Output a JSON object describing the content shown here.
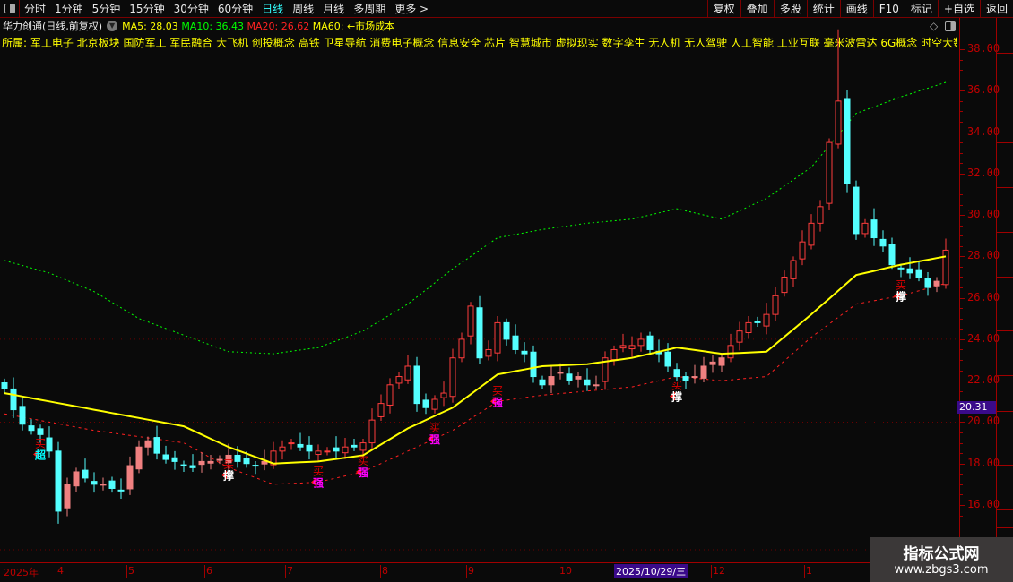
{
  "toolbar": {
    "periods": [
      "分时",
      "1分钟",
      "5分钟",
      "15分钟",
      "30分钟",
      "60分钟",
      "日线",
      "周线",
      "月线",
      "多周期",
      "更多 >"
    ],
    "active": "日线",
    "buttons": [
      "复权",
      "叠加",
      "多股",
      "统计",
      "画线",
      "F10",
      "标记",
      "+自选",
      "返回"
    ]
  },
  "header": {
    "title": "华力创通(日线,前复权)",
    "ma5": "MA5: 28.03",
    "ma10": "MA10: 36.43",
    "ma20": "MA20: 26.62",
    "ma60": "MA60:",
    "cost": "←市场成本",
    "ma_colors": {
      "ma5": "#ffff00",
      "ma10": "#00ff00",
      "ma20": "#ff2020",
      "ma60": "#ffff00"
    }
  },
  "concepts": "所属: 军工电子 北京板块 国防军工 军民融合 大飞机 创投概念 高铁 卫星导航 消费电子概念 信息安全 芯片 智慧城市 虚拟现实 数字孪生 无人机 无人驾驶 人工智能 工业互联 毫米波雷达 6G概念 时空大数据",
  "price_axis": {
    "ticks": [
      "38.00",
      "36.00",
      "34.00",
      "32.00",
      "30.00",
      "28.00",
      "26.00",
      "24.00",
      "22.00",
      "20.00",
      "18.00",
      "16.00"
    ],
    "current": "20.31"
  },
  "time_axis": {
    "labels": [
      "2025年",
      "4",
      "5",
      "6",
      "7",
      "8",
      "9",
      "10",
      "12",
      "1"
    ],
    "cursor_date": "2025/10/29/三"
  },
  "watermark": {
    "line1": "指标公式网",
    "line2": "www.zbgs3.com"
  },
  "chart_data": {
    "type": "candlestick",
    "ylim": [
      15,
      39
    ],
    "up_color": "#ff3c3c",
    "down_color": "#54ffff",
    "low_zone_color": "#f08080",
    "close": [
      21.6,
      20.6,
      19.9,
      19.6,
      19.4,
      18.6,
      15.7,
      17.0,
      17.6,
      17.3,
      17.0,
      17.0,
      16.8,
      16.7,
      17.9,
      18.8,
      19.1,
      18.5,
      18.2,
      18.1,
      17.9,
      17.8,
      18.1,
      18.1,
      18.2,
      18.4,
      18.1,
      18.0,
      17.9,
      18.1,
      18.6,
      18.8,
      19.0,
      18.8,
      18.6,
      18.6,
      18.6,
      18.6,
      18.8,
      18.8,
      19.0,
      20.1,
      20.9,
      21.8,
      22.2,
      22.7,
      20.9,
      20.7,
      21.1,
      21.4,
      23.1,
      24.0,
      25.6,
      23.1,
      23.5,
      24.8,
      24.0,
      23.5,
      23.3,
      22.2,
      21.8,
      22.2,
      22.4,
      22.0,
      22.2,
      21.8,
      21.8,
      23.1,
      23.5,
      23.7,
      23.7,
      24.0,
      23.5,
      23.3,
      22.7,
      22.2,
      22.0,
      22.2,
      22.7,
      22.9,
      23.1,
      23.7,
      24.4,
      24.8,
      24.8,
      25.2,
      26.1,
      27.0,
      27.8,
      28.7,
      29.6,
      30.4,
      33.5,
      35.5,
      31.5,
      29.1,
      29.6,
      28.9,
      28.5,
      27.6,
      27.4,
      27.2,
      27.0,
      26.5,
      26.8,
      28.3
    ],
    "market_cost": {
      "color": "#ffff00",
      "values": [
        21.4,
        21.0,
        20.6,
        20.2,
        19.8,
        18.8,
        18.0,
        18.1,
        18.4,
        19.7,
        20.7,
        22.3,
        22.7,
        22.8,
        23.1,
        23.6,
        23.3,
        23.4,
        25.2,
        27.1,
        27.6,
        28.0
      ]
    },
    "lower_band": {
      "color": "#ff2020",
      "values": [
        20.4,
        20.0,
        19.6,
        19.3,
        19.0,
        17.8,
        17.0,
        17.1,
        17.6,
        18.6,
        19.6,
        21.0,
        21.3,
        21.5,
        21.7,
        22.2,
        22.0,
        22.2,
        24.1,
        25.7,
        26.1,
        26.7
      ]
    },
    "upper_band": {
      "color": "#00ff00",
      "values": [
        27.8,
        27.2,
        26.3,
        25.0,
        24.2,
        23.4,
        23.3,
        23.6,
        24.4,
        25.7,
        27.4,
        28.9,
        29.3,
        29.6,
        29.8,
        30.3,
        29.8,
        30.8,
        32.3,
        34.9,
        35.7,
        36.4
      ]
    },
    "signals": [
      {
        "i": 4,
        "top": "买",
        "bottom": "超",
        "color": "#00ffff"
      },
      {
        "i": 25,
        "top": "买",
        "bottom": "撑",
        "color": "#ffffff"
      },
      {
        "i": 35,
        "top": "买",
        "bottom": "强",
        "color": "#ff00ff"
      },
      {
        "i": 40,
        "top": "买",
        "bottom": "强",
        "color": "#ff00ff"
      },
      {
        "i": 48,
        "top": "买",
        "bottom": "强",
        "color": "#ff00ff"
      },
      {
        "i": 55,
        "top": "买",
        "bottom": "强",
        "color": "#ff00ff"
      },
      {
        "i": 75,
        "top": "买",
        "bottom": "撑",
        "color": "#ffffff"
      },
      {
        "i": 100,
        "top": "买",
        "bottom": "撑",
        "color": "#ffffff"
      }
    ]
  }
}
